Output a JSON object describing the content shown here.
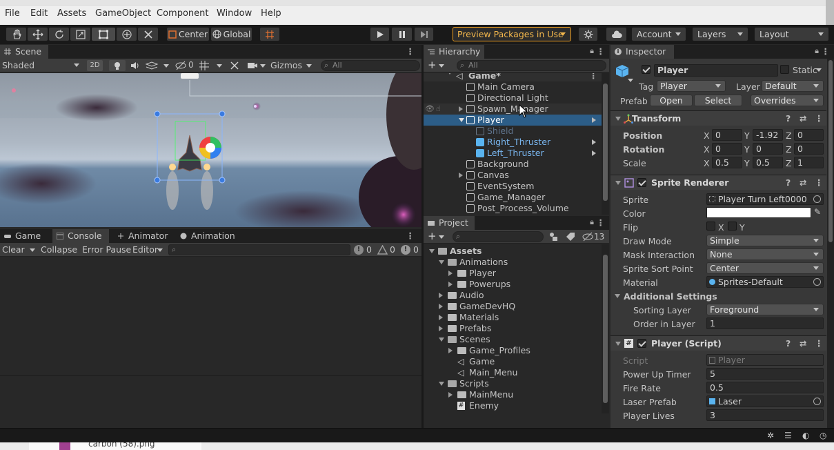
{
  "menubar": {
    "items": [
      "File",
      "Edit",
      "Assets",
      "GameObject",
      "Component",
      "Window",
      "Help"
    ]
  },
  "toolbar": {
    "pivot": "Center",
    "space": "Global",
    "preview_packages": "Preview Packages in Use",
    "account": "Account",
    "layers": "Layers",
    "layout": "Layout",
    "accent": "#f0a020"
  },
  "scene": {
    "tab": "Scene",
    "shading": "Shaded",
    "mode_2d": "2D",
    "hidden_count": "0",
    "gizmos": "Gizmos",
    "search_placeholder": "All"
  },
  "hierarchy": {
    "tab": "Hierarchy",
    "search_placeholder": "All",
    "scene_name": "Game*",
    "items": [
      {
        "label": "Main Camera",
        "depth": 1
      },
      {
        "label": "Directional Light",
        "depth": 1
      },
      {
        "label": "Spawn_Manager",
        "depth": 1,
        "expandable": true
      },
      {
        "label": "Player",
        "depth": 1,
        "selected": true,
        "expanded": true
      },
      {
        "label": "Shield",
        "depth": 2,
        "disabled": true
      },
      {
        "label": "Right_Thruster",
        "depth": 2,
        "prefab": true
      },
      {
        "label": "Left_Thruster",
        "depth": 2,
        "prefab": true
      },
      {
        "label": "Background",
        "depth": 1
      },
      {
        "label": "Canvas",
        "depth": 1,
        "expandable": true
      },
      {
        "label": "EventSystem",
        "depth": 1
      },
      {
        "label": "Game_Manager",
        "depth": 1
      },
      {
        "label": "Post_Process_Volume",
        "depth": 1
      }
    ]
  },
  "project": {
    "tab": "Project",
    "hidden_count": "13",
    "items": [
      {
        "label": "Assets",
        "depth": 0,
        "open": true,
        "bold": true
      },
      {
        "label": "Animations",
        "depth": 1,
        "open": true
      },
      {
        "label": "Player",
        "depth": 2
      },
      {
        "label": "Powerups",
        "depth": 2
      },
      {
        "label": "Audio",
        "depth": 1
      },
      {
        "label": "GameDevHQ",
        "depth": 1
      },
      {
        "label": "Materials",
        "depth": 1
      },
      {
        "label": "Prefabs",
        "depth": 1
      },
      {
        "label": "Scenes",
        "depth": 1,
        "open": true
      },
      {
        "label": "Game_Profiles",
        "depth": 2
      },
      {
        "label": "Game",
        "depth": 2,
        "unity": true
      },
      {
        "label": "Main_Menu",
        "depth": 2,
        "unity": true
      },
      {
        "label": "Scripts",
        "depth": 1,
        "open": true
      },
      {
        "label": "MainMenu",
        "depth": 2
      },
      {
        "label": "Enemy",
        "depth": 2,
        "script": true
      }
    ]
  },
  "console": {
    "tabs": [
      "Game",
      "Console",
      "Animator",
      "Animation"
    ],
    "clear": "Clear",
    "collapse": "Collapse",
    "error_pause": "Error Pause",
    "editor": "Editor",
    "log_count": "0",
    "warn_count": "0",
    "error_count": "0"
  },
  "inspector": {
    "tab": "Inspector",
    "object_name": "Player",
    "static_label": "Static",
    "tag_label": "Tag",
    "tag_value": "Player",
    "layer_label": "Layer",
    "layer_value": "Default",
    "prefab_label": "Prefab",
    "open": "Open",
    "select": "Select",
    "overrides": "Overrides",
    "transform": {
      "title": "Transform",
      "position_label": "Position",
      "rotation_label": "Rotation",
      "scale_label": "Scale",
      "position": [
        "0",
        "-1.92",
        "0"
      ],
      "rotation": [
        "0",
        "0",
        "0"
      ],
      "scale": [
        "0.5",
        "0.5",
        "1"
      ]
    },
    "sprite_renderer": {
      "title": "Sprite Renderer",
      "rows": [
        {
          "label": "Sprite",
          "value": "Player Turn Left0000"
        },
        {
          "label": "Color",
          "value": ""
        },
        {
          "label": "Flip",
          "value": ""
        },
        {
          "label": "Draw Mode",
          "value": "Simple"
        },
        {
          "label": "Mask Interaction",
          "value": "None"
        },
        {
          "label": "Sprite Sort Point",
          "value": "Center"
        },
        {
          "label": "Material",
          "value": "Sprites-Default"
        }
      ],
      "flip_x": "X",
      "flip_y": "Y",
      "additional": "Additional Settings",
      "sorting_layer_label": "Sorting Layer",
      "sorting_layer": "Foreground",
      "order_label": "Order in Layer",
      "order": "1"
    },
    "player_script": {
      "title": "Player (Script)",
      "rows": [
        {
          "label": "Script",
          "value": "Player"
        },
        {
          "label": "Power Up Timer",
          "value": "5"
        },
        {
          "label": "Fire Rate",
          "value": "0.5"
        },
        {
          "label": "Laser Prefab",
          "value": "Laser"
        },
        {
          "label": "Player Lives",
          "value": "3"
        }
      ]
    }
  },
  "taskbar": {
    "file": "carbon (58).png"
  }
}
